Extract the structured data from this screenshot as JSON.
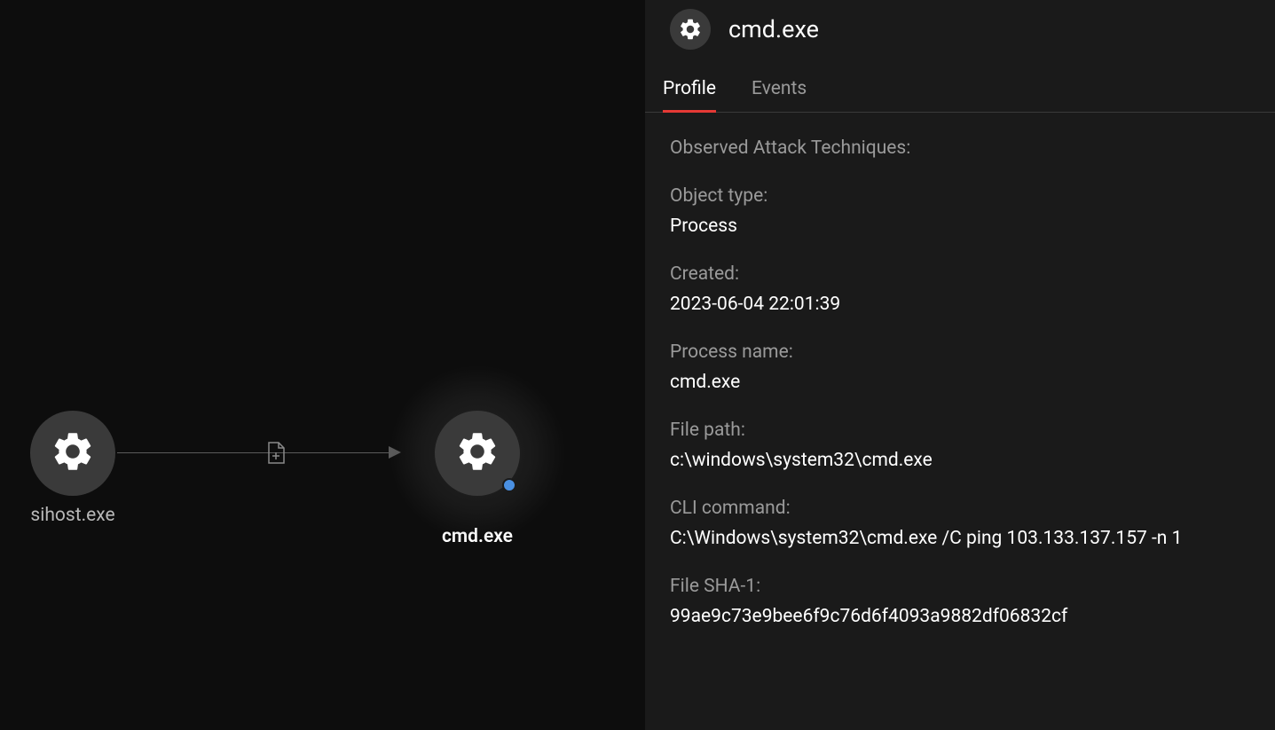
{
  "graph": {
    "nodes": [
      {
        "id": "sihost",
        "label": "sihost.exe",
        "icon": "gear",
        "selected": false
      },
      {
        "id": "cmd",
        "label": "cmd.exe",
        "icon": "gear",
        "selected": true,
        "status_dot": true
      }
    ],
    "edge": {
      "icon": "file-plus"
    }
  },
  "detail": {
    "title": "cmd.exe",
    "tabs": [
      {
        "id": "profile",
        "label": "Profile",
        "active": true
      },
      {
        "id": "events",
        "label": "Events",
        "active": false
      }
    ],
    "profile": {
      "observed_label": "Observed Attack Techniques:",
      "fields": [
        {
          "label": "Object type:",
          "value": "Process"
        },
        {
          "label": "Created:",
          "value": "2023-06-04 22:01:39"
        },
        {
          "label": "Process name:",
          "value": "cmd.exe"
        },
        {
          "label": "File path:",
          "value": "c:\\windows\\system32\\cmd.exe"
        },
        {
          "label": "CLI command:",
          "value": "C:\\Windows\\system32\\cmd.exe /C ping 103.133.137.157 -n 1"
        },
        {
          "label": "File SHA-1:",
          "value": "99ae9c73e9bee6f9c76d6f4093a9882df06832cf"
        }
      ]
    }
  }
}
